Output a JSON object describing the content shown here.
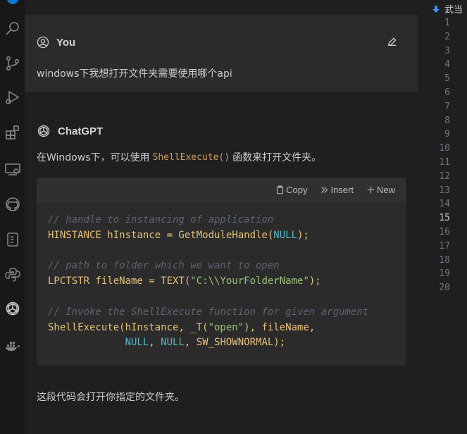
{
  "activity_bar": {
    "icons": [
      "search-icon",
      "source-control-icon",
      "run-debug-icon",
      "extensions-icon",
      "remote-explorer-icon",
      "github-icon",
      "device-icon",
      "python-icon",
      "chatgpt-icon",
      "docker-icon"
    ],
    "accent": "#0078d4"
  },
  "chat": {
    "user": {
      "name": "You",
      "message": "windows下我想打开文件夹需要使用哪个api"
    },
    "assistant": {
      "name": "ChatGPT",
      "intro_before": "在Windows下，可以使用",
      "intro_code": "ShellExecute()",
      "intro_after": "函数来打开文件夹。",
      "outro": "这段代码会打开你指定的文件夹。"
    },
    "code_block": {
      "toolbar": {
        "copy": "Copy",
        "insert": "Insert",
        "new": "New"
      },
      "lines": [
        {
          "comment": "// handle to instancing of application"
        },
        {
          "t1": "HINSTANCE hInstance = GetModuleHandle(",
          "t2": "NULL",
          "t3": ");"
        },
        {
          "blank": ""
        },
        {
          "comment": "// path to folder which we want to open"
        },
        {
          "t1": "LPCTSTR fileName = TEXT(",
          "t2": "\"C:\\\\YourFolderName\"",
          "t3": ");"
        },
        {
          "blank": ""
        },
        {
          "comment": "// Invoke the ShellExecute function for given argument"
        },
        {
          "t1": "ShellExecute(hInstance, _T(",
          "t2": "\"open\"",
          "t3": "), fileName,"
        },
        {
          "indent": "             ",
          "a": "NULL",
          "b": ", ",
          "c": "NULL",
          "d": ", SW_SHOWNORMAL);"
        }
      ]
    }
  },
  "editor": {
    "tab_title": "武当",
    "line_numbers": [
      "1",
      "2",
      "3",
      "4",
      "5",
      "6",
      "7",
      "8",
      "9",
      "10",
      "11",
      "12",
      "13",
      "14",
      "15",
      "16",
      "17",
      "18",
      "19",
      "20"
    ],
    "active_line": "15"
  }
}
